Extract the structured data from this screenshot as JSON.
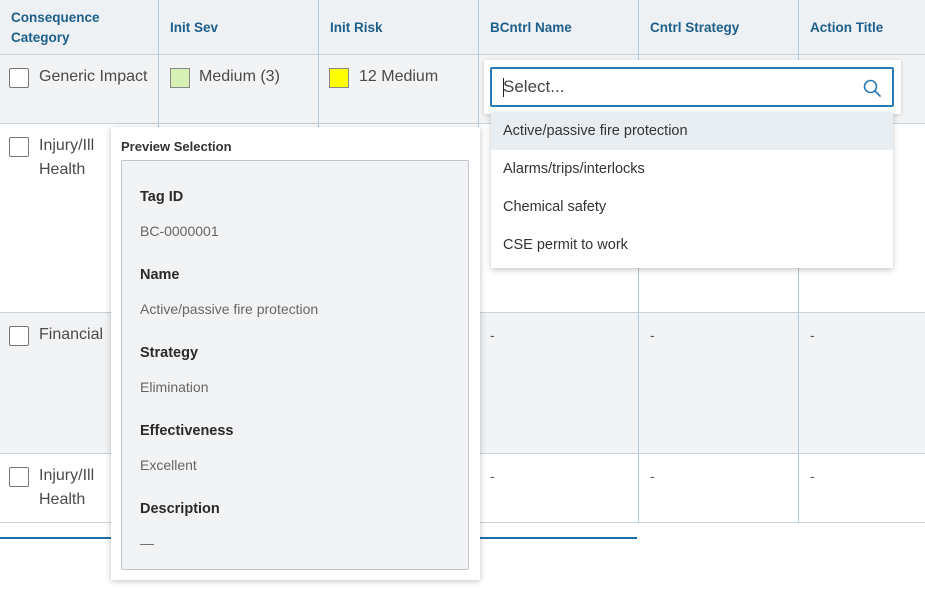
{
  "table": {
    "headers": [
      "Consequence Category",
      "Init Sev",
      "Init Risk",
      "BCntrl Name",
      "Cntrl Strategy",
      "Action Title"
    ],
    "rows": [
      {
        "category": "Generic Impact",
        "severity": "Medium (3)",
        "severity_color": "#d7f0b4",
        "risk": "12 Medium",
        "risk_color": "#ffff00"
      },
      {
        "category": "Injury/Ill Health"
      },
      {
        "category": "Financial",
        "bcntrl": "-",
        "strategy": "-",
        "action": "-"
      },
      {
        "category": "Injury/Ill Health",
        "bcntrl": "-",
        "strategy": "-",
        "action": "-"
      }
    ]
  },
  "preview": {
    "title": "Preview Selection",
    "fields": [
      {
        "label": "Tag ID",
        "value": "BC-0000001"
      },
      {
        "label": "Name",
        "value": "Active/passive fire protection"
      },
      {
        "label": "Strategy",
        "value": "Elimination"
      },
      {
        "label": "Effectiveness",
        "value": "Excellent"
      },
      {
        "label": "Description",
        "value": "—"
      }
    ]
  },
  "select": {
    "placeholder": "Select...",
    "options": [
      "Active/passive fire protection",
      "Alarms/trips/interlocks",
      "Chemical safety",
      "CSE permit to work"
    ],
    "active_index": 0
  },
  "colors": {
    "header_text": "#1d5f8a",
    "accent": "#2a7ab5"
  }
}
